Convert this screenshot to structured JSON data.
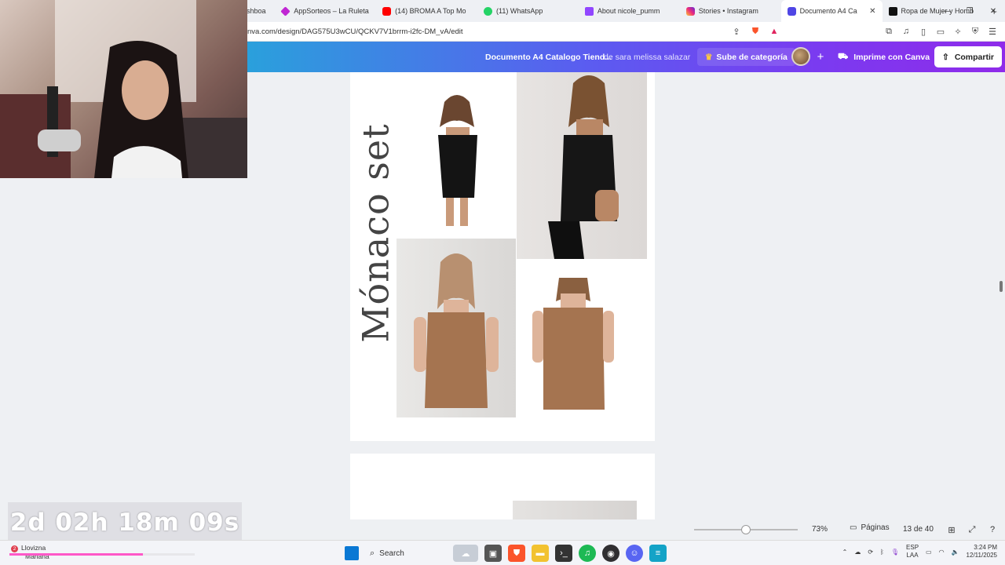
{
  "browser": {
    "tabs": [
      {
        "label": "shboa",
        "icon": "dashboard-icon",
        "color": "#4a5fd1"
      },
      {
        "label": "AppSorteos – La Ruleta",
        "icon": "appsorteos-icon",
        "color": "#c026d3"
      },
      {
        "label": "(14) BROMA A Top Mo",
        "icon": "youtube-icon",
        "color": "#ff0000"
      },
      {
        "label": "(11) WhatsApp",
        "icon": "whatsapp-icon",
        "color": "#25d366"
      },
      {
        "label": "About nicole_pumm",
        "icon": "twitch-icon",
        "color": "#9146ff"
      },
      {
        "label": "Stories • Instagram",
        "icon": "instagram-icon",
        "color": "#e1306c"
      },
      {
        "label": "Documento A4 Ca",
        "icon": "canva-icon",
        "color": "#4f46e5",
        "active": true
      },
      {
        "label": "Ropa de Mujer y Homb",
        "icon": "shein-icon",
        "color": "#111111"
      }
    ],
    "url": "nva.com/design/DAG575U3wCU/QCKV7V1brrm-i2fc-DM_vA/edit"
  },
  "canva": {
    "doc_title": "Documento A4 Catalogo Tiend...",
    "author": "de sara melissa salazar",
    "upgrade_label": "Sube de categoría",
    "print_label": "Imprime con Canva",
    "share_label": "Compartir",
    "page_title": "Mónaco set",
    "zoom": "73%",
    "zoom_fraction": 0.5,
    "pages_label": "Páginas",
    "page_count": "13 de 40"
  },
  "stream": {
    "timer": "2d 02h 18m 09s",
    "progress_fraction": 0.72
  },
  "taskbar": {
    "weather_label": "Llovizna",
    "weather_sub": "Mañana",
    "weather_badge": "2",
    "search_placeholder": "Search",
    "lang_line1": "ESP",
    "lang_line2": "LAA",
    "time": "3:24 PM",
    "date": "12/11/2025"
  },
  "colors": {
    "accent_canva": "#7a3bf0",
    "progress_pink": "#ff58c8"
  }
}
